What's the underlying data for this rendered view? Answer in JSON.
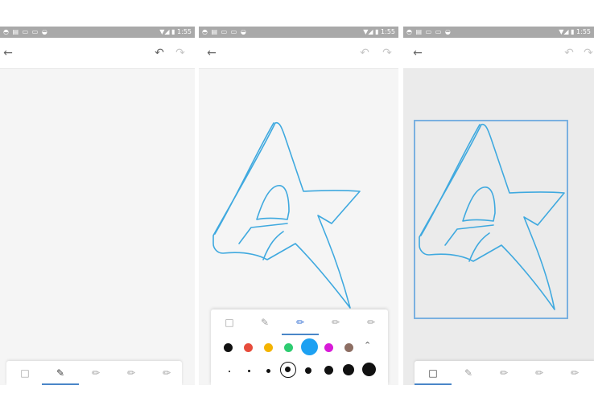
{
  "panels": [
    {
      "status": {
        "left_icons": "◓ ▤ ▭ ▭ ◒",
        "right_icons": "▼◢ ▮ 1:55"
      },
      "toolbar": {
        "back_icon": "arrow-left-icon",
        "undo_icon": "undo-icon",
        "redo_icon": "redo-icon"
      },
      "active_tool": "eraser"
    },
    {
      "status": {
        "left_icons": "◓ ▤ ▭ ▭ ◒",
        "right_icons": "▼◢ ▮ 1:55"
      },
      "toolbar": {
        "back_icon": "arrow-left-icon",
        "undo_icon": "undo-icon",
        "redo_icon": "redo-icon"
      },
      "active_tool": "pen",
      "pen_panel": {
        "colors": [
          "#111111",
          "#e74c3c",
          "#f4b400",
          "#2ecc71",
          "#1da1f2",
          "#d81bd8",
          "#8d6e63"
        ],
        "selected_color": "#1da1f2",
        "collapse_icon": "chevron-up-icon",
        "sizes_selected_index": 3
      }
    },
    {
      "status": {
        "left_icons": "◓ ▤ ▭ ▭ ◒",
        "right_icons": "▼◢ ▮ 1:55"
      },
      "toolbar": {
        "back_icon": "arrow-left-icon",
        "undo_icon": "undo-icon",
        "redo_icon": "redo-icon"
      },
      "active_tool": "select"
    }
  ],
  "stroke_color": "#3fa9df"
}
